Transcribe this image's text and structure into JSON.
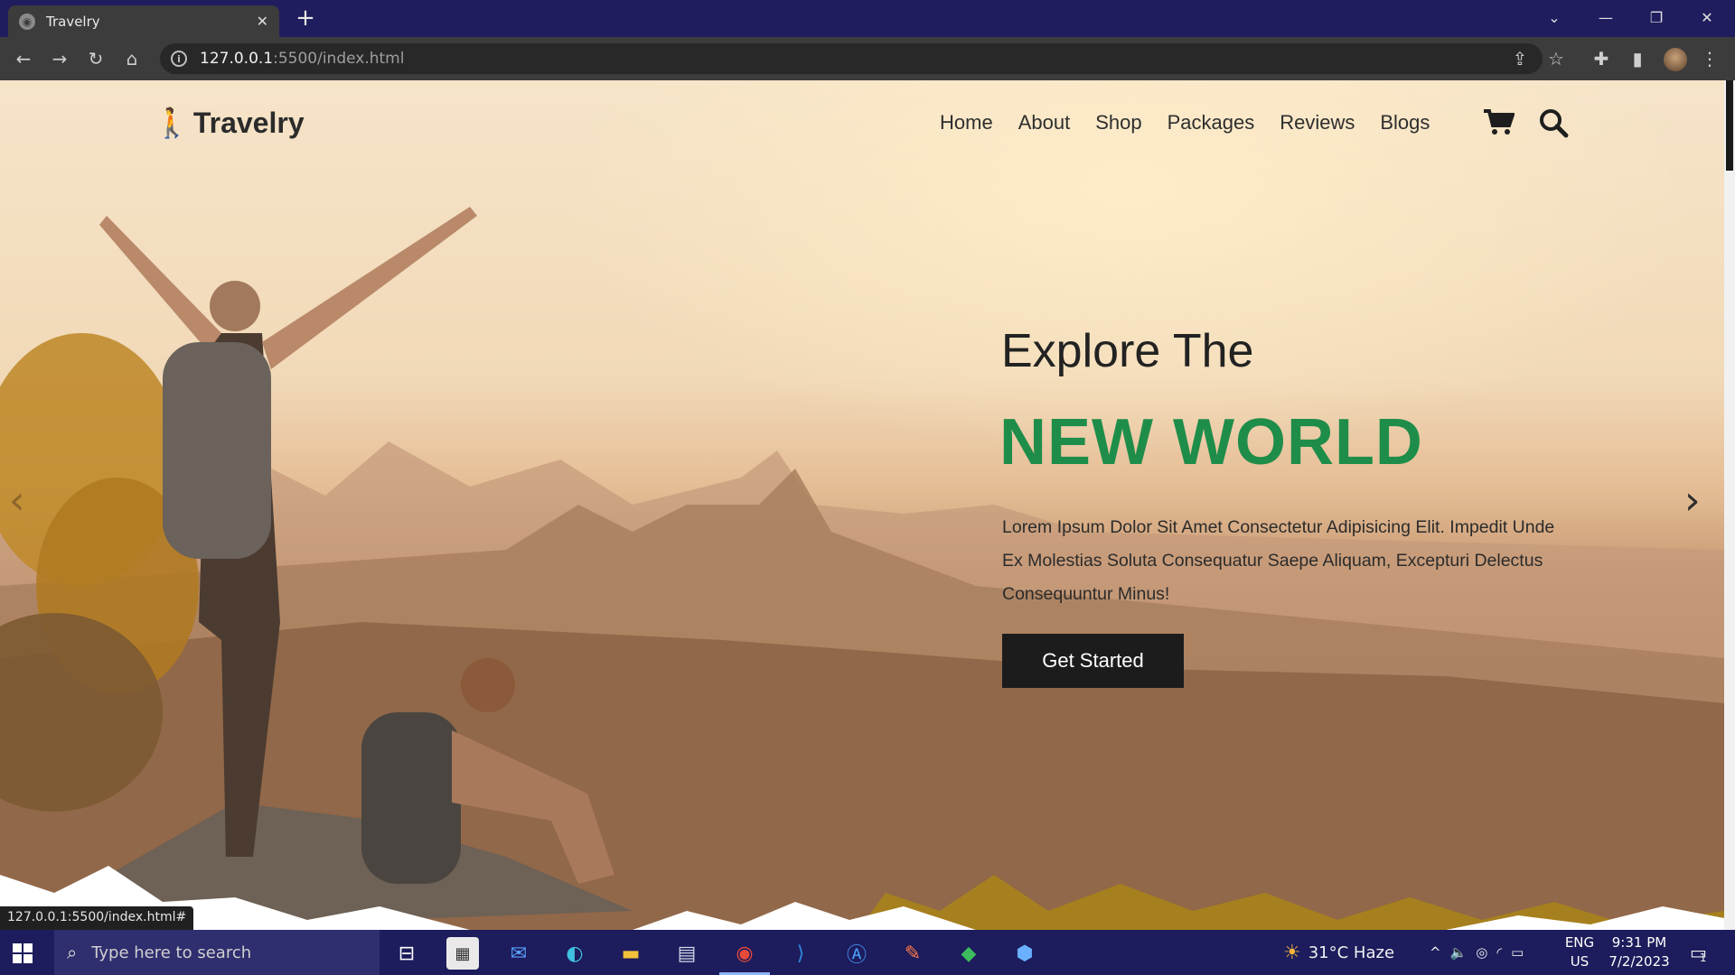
{
  "browser": {
    "tab_title": "Travelry",
    "url_host": "127.0.0.1",
    "url_path": ":5500/index.html",
    "status_url": "127.0.0.1:5500/index.html#"
  },
  "site": {
    "logo": "Travelry",
    "nav": [
      "Home",
      "About",
      "Shop",
      "Packages",
      "Reviews",
      "Blogs"
    ],
    "hero": {
      "subtitle": "Explore The",
      "title": "NEW WORLD",
      "description": "Lorem Ipsum Dolor Sit Amet Consectetur Adipisicing Elit. Impedit Unde Ex Molestias Soluta Consequatur Saepe Aliquam, Excepturi Delectus Consequuntur Minus!",
      "cta": "Get Started"
    },
    "accent_color": "#1f8d4a"
  },
  "taskbar": {
    "search_placeholder": "Type here to search",
    "weather": "31°C  Haze",
    "lang_line1": "ENG",
    "lang_line2": "US",
    "time": "9:31 PM",
    "date": "7/2/2023",
    "notification_count": "1"
  }
}
